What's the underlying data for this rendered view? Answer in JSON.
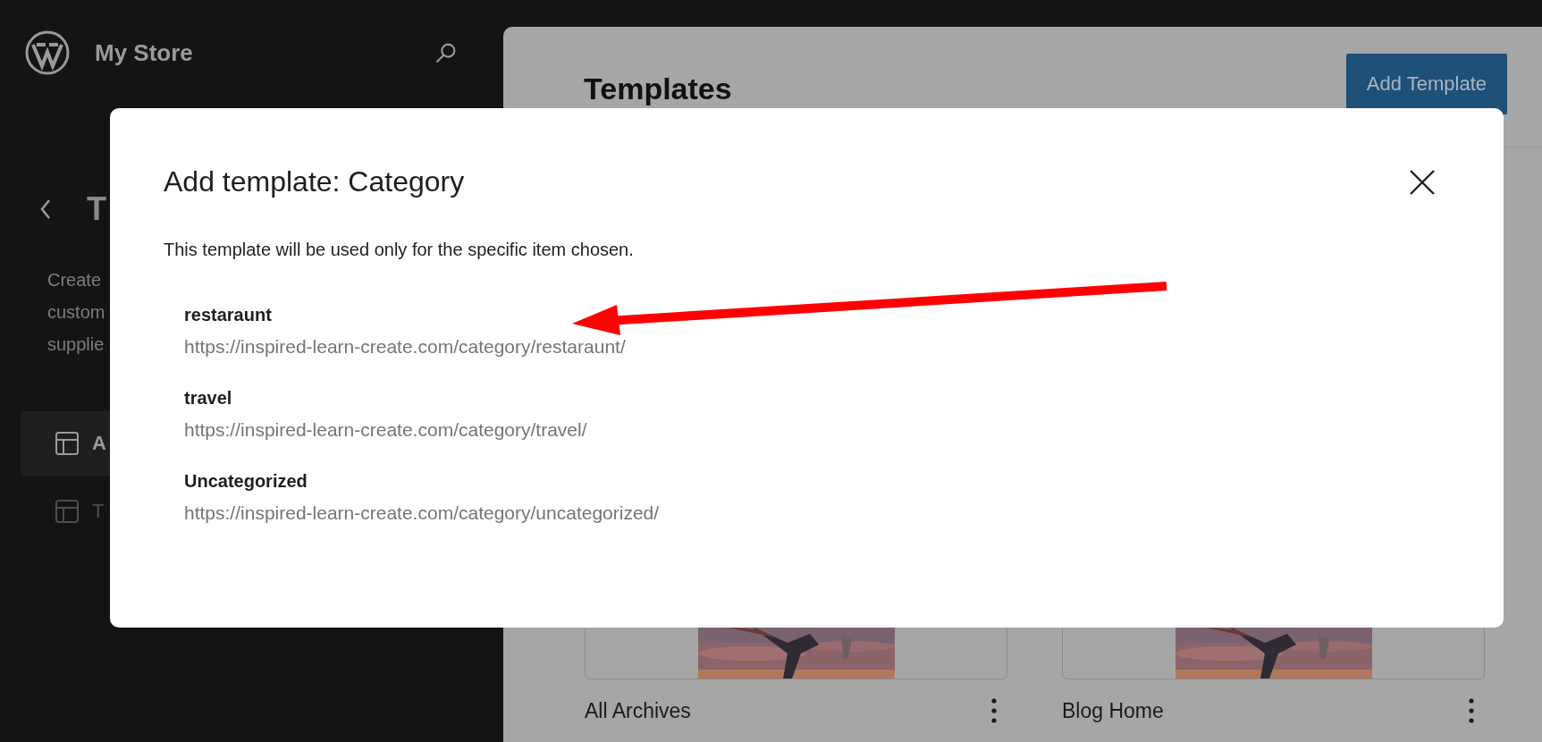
{
  "sidebar": {
    "site_title": "My Store",
    "back_heading": "T",
    "description_lines": [
      "Create",
      "custom",
      "supplie"
    ],
    "nav_items": [
      {
        "label": "A",
        "selected": true
      },
      {
        "label": "T",
        "selected": false
      }
    ]
  },
  "main": {
    "title": "Templates",
    "add_button": "Add Template",
    "cards": [
      {
        "title": "All Archives"
      },
      {
        "title": "Blog Home"
      }
    ]
  },
  "modal": {
    "title": "Add template: Category",
    "description": "This template will be used only for the specific item chosen.",
    "items": [
      {
        "name": "restaraunt",
        "url": "https://inspired-learn-create.com/category/restaraunt/"
      },
      {
        "name": "travel",
        "url": "https://inspired-learn-create.com/category/travel/"
      },
      {
        "name": "Uncategorized",
        "url": "https://inspired-learn-create.com/category/uncategorized/"
      }
    ]
  }
}
